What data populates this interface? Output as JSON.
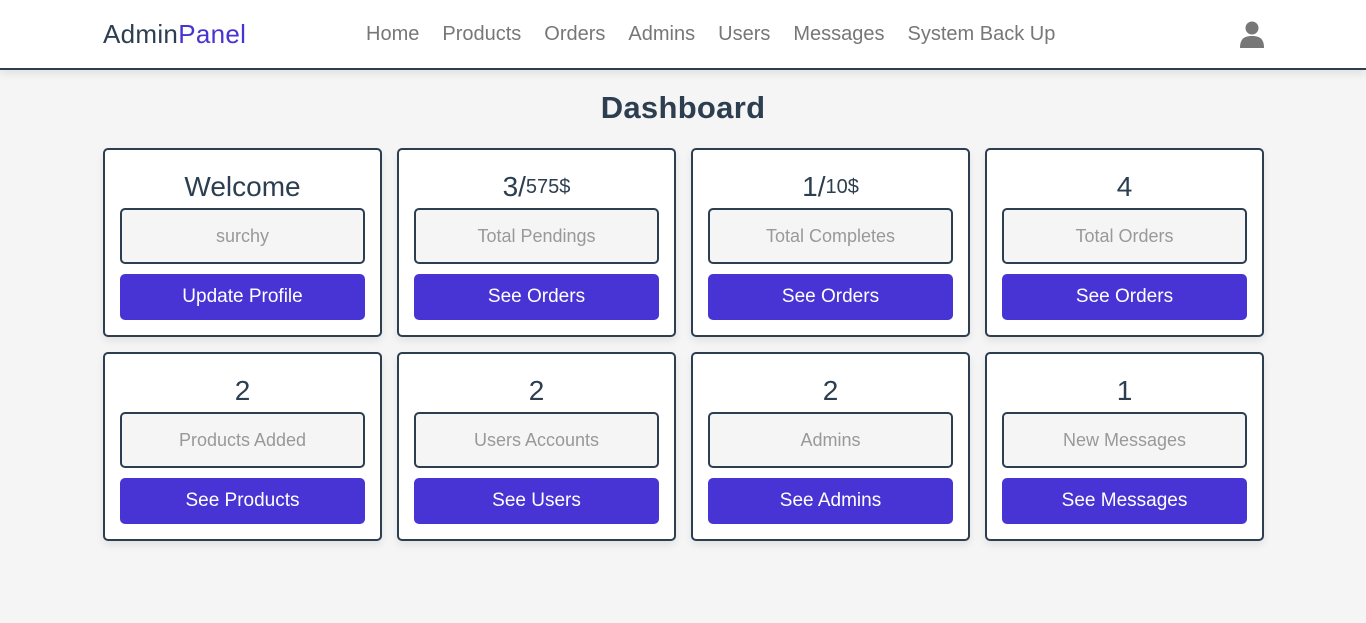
{
  "header": {
    "logo_main": "Admin",
    "logo_accent": "Panel",
    "nav": [
      "Home",
      "Products",
      "Orders",
      "Admins",
      "Users",
      "Messages",
      "System Back Up"
    ]
  },
  "page_title": "Dashboard",
  "cards": [
    {
      "value": "Welcome",
      "value_small": "",
      "box": "surchy",
      "button": "Update Profile"
    },
    {
      "value": "3/",
      "value_small": "575$",
      "box": "Total Pendings",
      "button": "See Orders"
    },
    {
      "value": "1/",
      "value_small": "10$",
      "box": "Total Completes",
      "button": "See Orders"
    },
    {
      "value": "4",
      "value_small": "",
      "box": "Total Orders",
      "button": "See Orders"
    },
    {
      "value": "2",
      "value_small": "",
      "box": "Products Added",
      "button": "See Products"
    },
    {
      "value": "2",
      "value_small": "",
      "box": "Users Accounts",
      "button": "See Users"
    },
    {
      "value": "2",
      "value_small": "",
      "box": "Admins",
      "button": "See Admins"
    },
    {
      "value": "1",
      "value_small": "",
      "box": "New Messages",
      "button": "See Messages"
    }
  ],
  "colors": {
    "accent": "#4834d4",
    "text": "#2c3e50",
    "muted": "#999999",
    "background": "#f5f5f5"
  },
  "icons": {
    "profile": "user-icon"
  }
}
